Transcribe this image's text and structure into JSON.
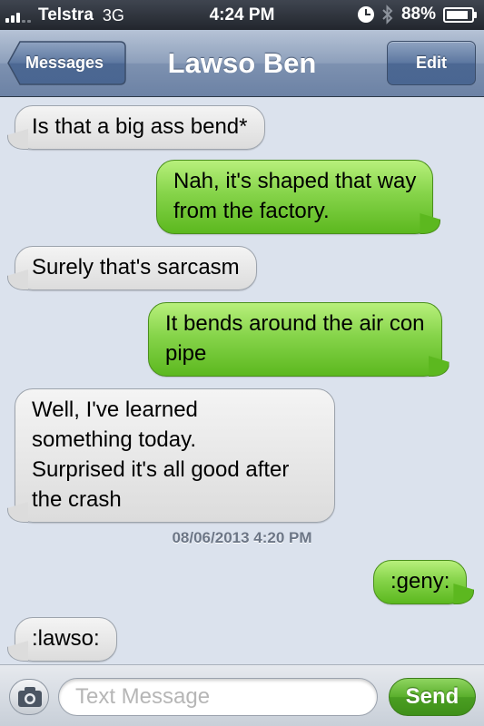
{
  "status_bar": {
    "carrier": "Telstra",
    "network": "3G",
    "time": "4:24 PM",
    "battery": "88%",
    "battery_level": 0.88,
    "icons": [
      "signal-icon",
      "clock-icon",
      "bluetooth-icon",
      "battery-icon"
    ]
  },
  "nav": {
    "back_label": "Messages",
    "title": "Lawso Ben",
    "edit_label": "Edit"
  },
  "messages": [
    {
      "direction": "in",
      "text": "Is that a big ass bend*"
    },
    {
      "direction": "out",
      "text": "Nah, it's shaped that way\nfrom the factory."
    },
    {
      "direction": "in",
      "text": "Surely that's sarcasm"
    },
    {
      "direction": "out",
      "text": "It bends around the air con\npipe"
    },
    {
      "direction": "in",
      "text": "Well, I've learned\nsomething today.\nSurprised it's all good after\nthe crash"
    },
    {
      "direction": "out",
      "text": ":geny:"
    },
    {
      "direction": "in",
      "text": ":lawso:"
    }
  ],
  "timestamp": "08/06/2013 4:20 PM",
  "composer": {
    "placeholder": "Text Message",
    "value": "",
    "send_label": "Send"
  },
  "colors": {
    "thread_background": "#dbe2ed",
    "outgoing_bubble": "#86d44a",
    "incoming_bubble": "#e8e8e8",
    "nav_bar": "#8d9fbb",
    "send_button": "#5aaf2c"
  }
}
